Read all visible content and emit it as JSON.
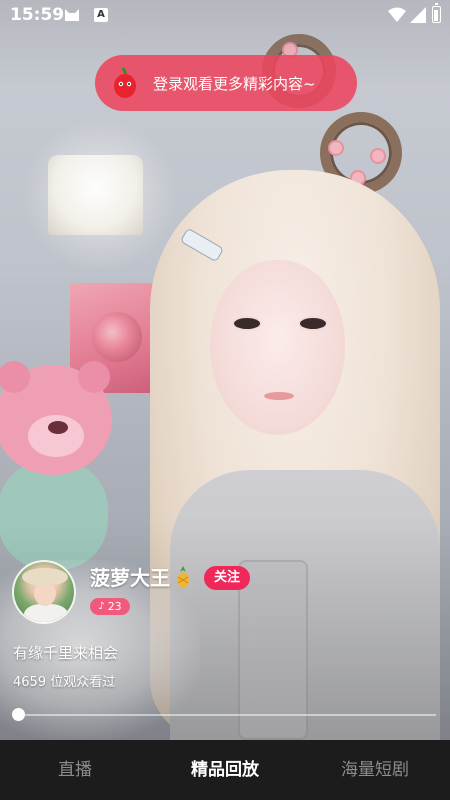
{
  "status_bar": {
    "time": "15:59",
    "icons": [
      "cat-icon",
      "a-icon",
      "wifi-icon",
      "signal-icon",
      "battery-icon"
    ],
    "a_icon_text": "A"
  },
  "login_banner": {
    "icon": "pepper-icon",
    "text": "登录观看更多精彩内容~",
    "color": "#ec465f"
  },
  "streamer": {
    "name": "菠萝大王",
    "name_icon": "pineapple-icon",
    "follow_label": "关注",
    "level": "23",
    "level_icon": "mic-icon",
    "motto": "有缘千里来相会",
    "viewers": "4659 位观众看过"
  },
  "playback": {
    "progress": 0.0
  },
  "bottom_nav": {
    "tabs": [
      {
        "label": "直播",
        "active": false
      },
      {
        "label": "精品回放",
        "active": true
      },
      {
        "label": "海量短剧",
        "active": false
      }
    ]
  },
  "colors": {
    "accent": "#f0285a",
    "badge": "#f25a7c",
    "nav_bg": "#1c1c1c"
  }
}
